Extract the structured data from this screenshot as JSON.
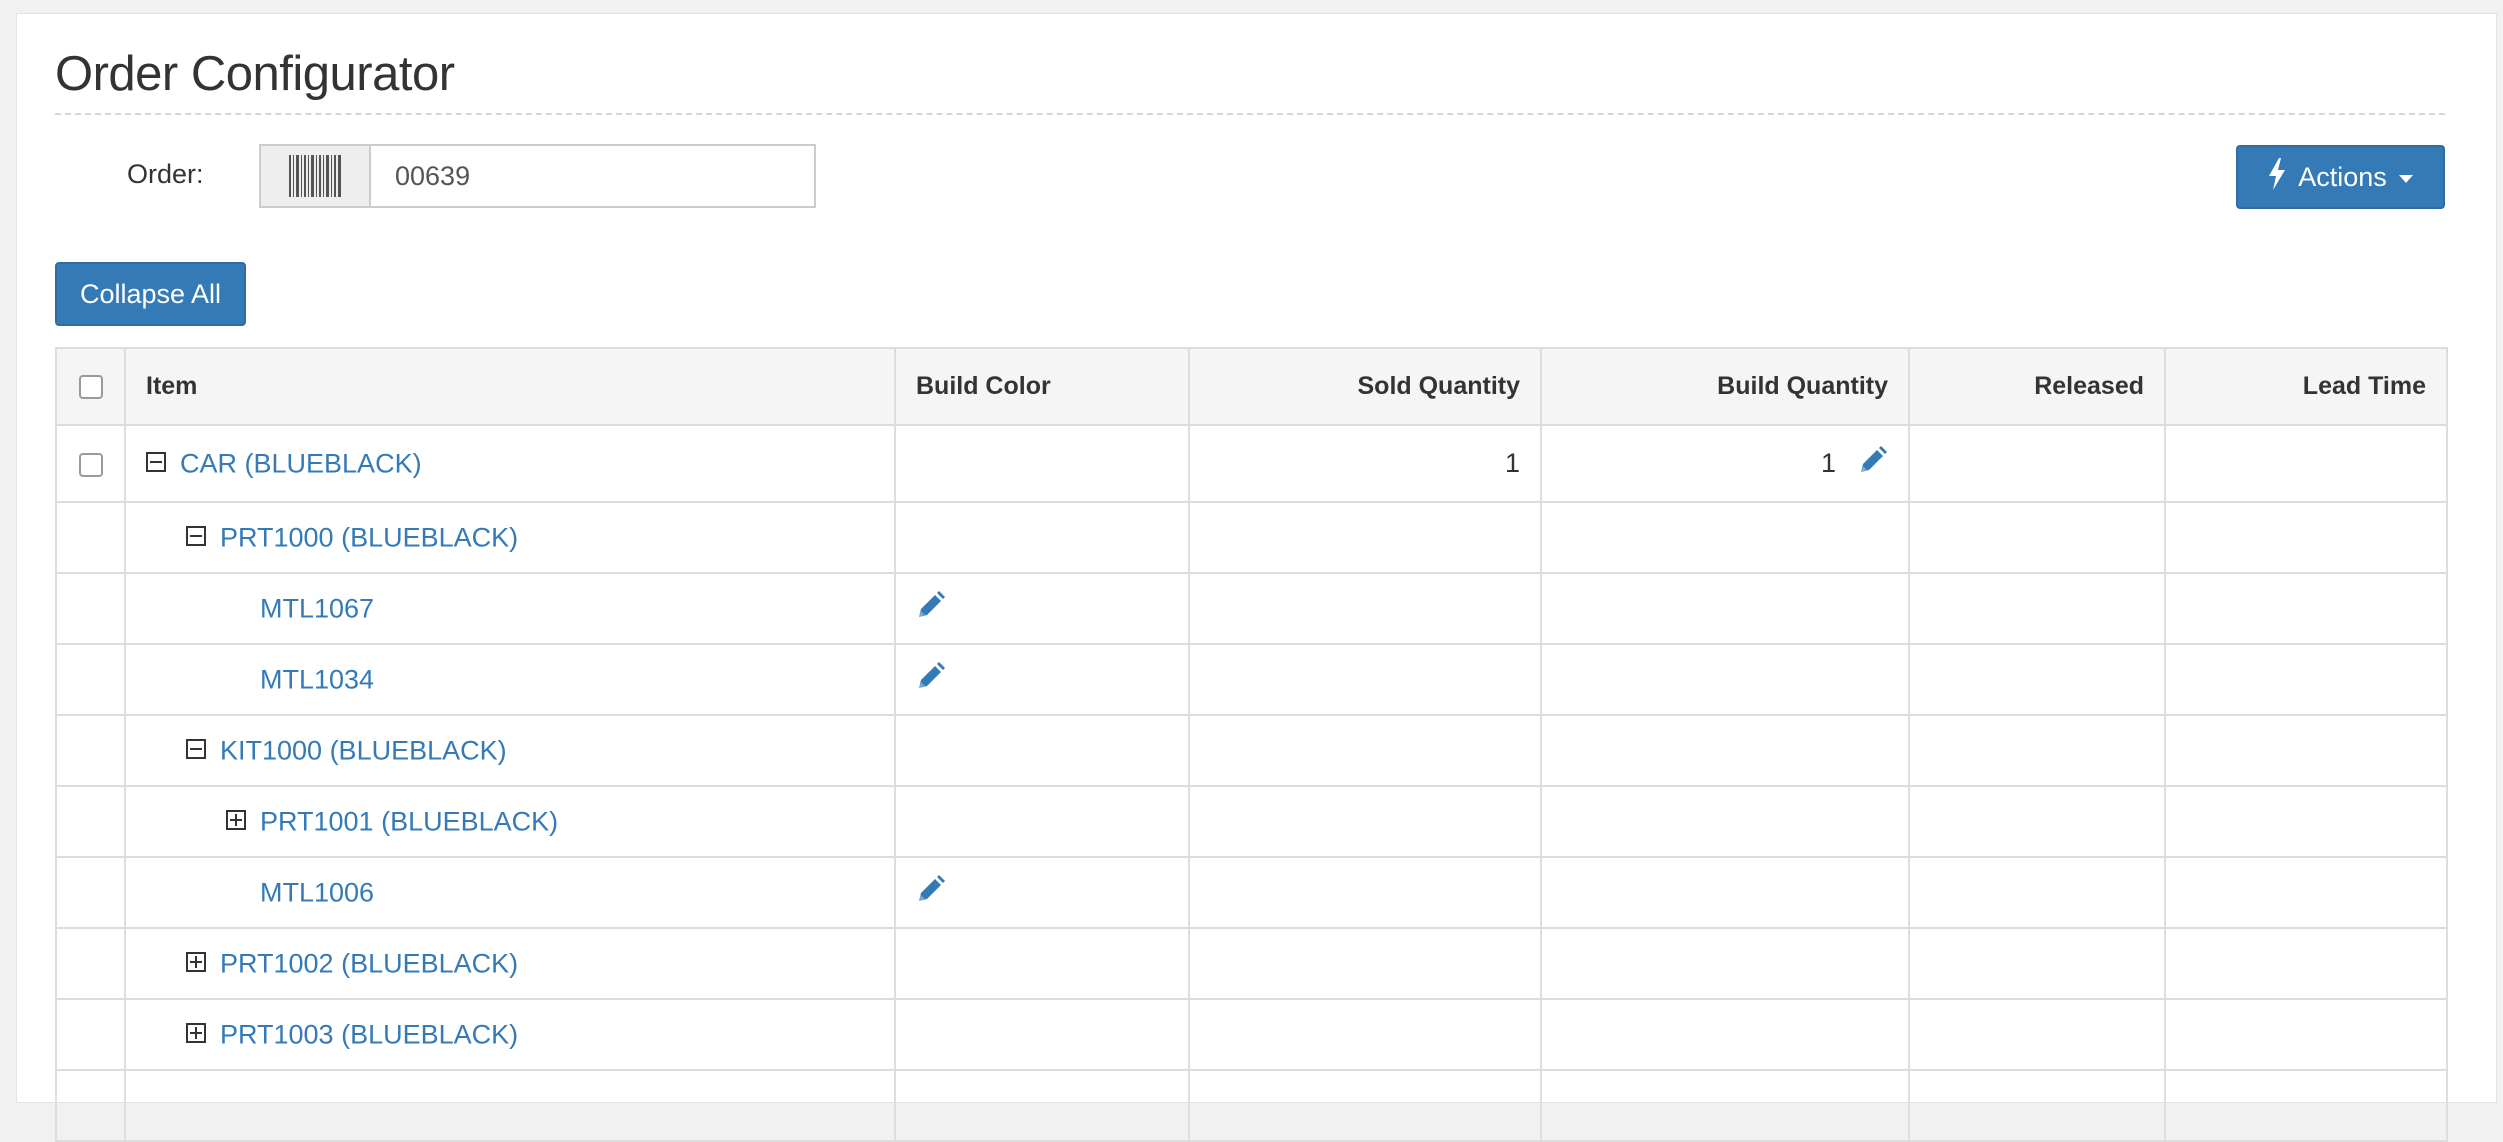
{
  "page": {
    "title": "Order Configurator"
  },
  "order": {
    "label": "Order:",
    "value": "00639"
  },
  "toolbar": {
    "actions_label": "Actions",
    "collapse_label": "Collapse All"
  },
  "icons": {
    "barcode": "barcode-icon",
    "bolt": "bolt-icon",
    "caret": "caret-down-icon",
    "pencil": "pencil-icon",
    "collapse": "minus-square-icon",
    "expand": "plus-square-icon"
  },
  "colors": {
    "primary": "#337ab7",
    "link": "#337ab7",
    "header_bg": "#f5f5f5"
  },
  "table": {
    "columns": [
      "Item",
      "Build Color",
      "Sold Quantity",
      "Build Quantity",
      "Released",
      "Lead Time"
    ],
    "rows": [
      {
        "item": "CAR (BLUEBLACK)",
        "level": 0,
        "toggle": "collapse",
        "checkbox": true,
        "build_color_edit": false,
        "sold_quantity": "1",
        "build_quantity": "1",
        "build_quantity_edit": true,
        "released": "",
        "lead_time": ""
      },
      {
        "item": "PRT1000 (BLUEBLACK)",
        "level": 1,
        "toggle": "collapse",
        "checkbox": false,
        "build_color_edit": false,
        "sold_quantity": "",
        "build_quantity": "",
        "build_quantity_edit": false,
        "released": "",
        "lead_time": ""
      },
      {
        "item": "MTL1067",
        "level": 2,
        "toggle": "none",
        "checkbox": false,
        "build_color_edit": true,
        "sold_quantity": "",
        "build_quantity": "",
        "build_quantity_edit": false,
        "released": "",
        "lead_time": ""
      },
      {
        "item": "MTL1034",
        "level": 2,
        "toggle": "none",
        "checkbox": false,
        "build_color_edit": true,
        "sold_quantity": "",
        "build_quantity": "",
        "build_quantity_edit": false,
        "released": "",
        "lead_time": ""
      },
      {
        "item": "KIT1000 (BLUEBLACK)",
        "level": 1,
        "toggle": "collapse",
        "checkbox": false,
        "build_color_edit": false,
        "sold_quantity": "",
        "build_quantity": "",
        "build_quantity_edit": false,
        "released": "",
        "lead_time": ""
      },
      {
        "item": "PRT1001 (BLUEBLACK)",
        "level": 2,
        "toggle": "expand",
        "checkbox": false,
        "build_color_edit": false,
        "sold_quantity": "",
        "build_quantity": "",
        "build_quantity_edit": false,
        "released": "",
        "lead_time": ""
      },
      {
        "item": "MTL1006",
        "level": 2,
        "toggle": "none",
        "checkbox": false,
        "build_color_edit": true,
        "sold_quantity": "",
        "build_quantity": "",
        "build_quantity_edit": false,
        "released": "",
        "lead_time": ""
      },
      {
        "item": "PRT1002 (BLUEBLACK)",
        "level": 1,
        "toggle": "expand",
        "checkbox": false,
        "build_color_edit": false,
        "sold_quantity": "",
        "build_quantity": "",
        "build_quantity_edit": false,
        "released": "",
        "lead_time": ""
      },
      {
        "item": "PRT1003 (BLUEBLACK)",
        "level": 1,
        "toggle": "expand",
        "checkbox": false,
        "build_color_edit": false,
        "sold_quantity": "",
        "build_quantity": "",
        "build_quantity_edit": false,
        "released": "",
        "lead_time": ""
      },
      {
        "item": "",
        "level": 1,
        "toggle": "none",
        "checkbox": false,
        "build_color_edit": false,
        "sold_quantity": "",
        "build_quantity": "",
        "build_quantity_edit": false,
        "released": "",
        "lead_time": ""
      }
    ]
  }
}
